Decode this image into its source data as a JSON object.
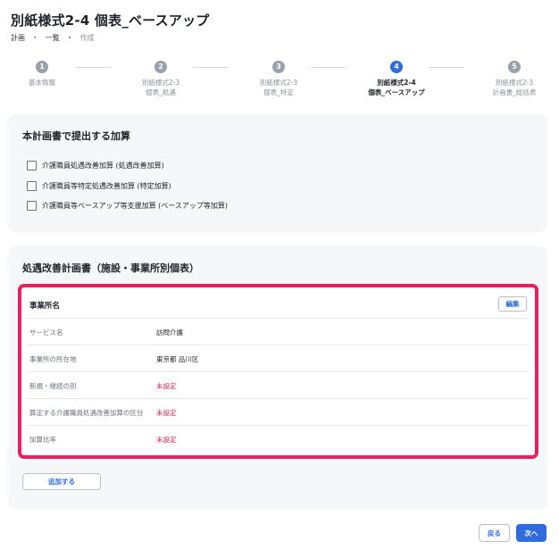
{
  "page": {
    "title": "別紙様式2-4 個表_ベースアップ"
  },
  "breadcrumb": [
    "計画",
    "一覧",
    "作成"
  ],
  "breadcrumb_separator": "•",
  "stepper": {
    "steps": [
      {
        "number": "1",
        "line1": "基本情報",
        "line2": ""
      },
      {
        "number": "2",
        "line1": "別紙様式2-3",
        "line2": "個表_処遇"
      },
      {
        "number": "3",
        "line1": "別紙様式2-3",
        "line2": "個表_特定"
      },
      {
        "number": "4",
        "line1": "別紙様式2-4",
        "line2": "個表_ベースアップ"
      },
      {
        "number": "5",
        "line1": "別紙様式2-3",
        "line2": "計画書_総括表"
      }
    ],
    "active_index": 3
  },
  "additions": {
    "title": "本計画書で提出する加算",
    "options": [
      "介護職員処遇改善加算 (処遇改善加算)",
      "介護職員等特定処遇改善加算 (特定加算)",
      "介護職員等ベースアップ等支援加算 (ベースアップ等加算)"
    ]
  },
  "plan": {
    "title": "処遇改善計画書（施設・事業所別個表）",
    "facility": {
      "header": "事業所名",
      "edit_label": "編集",
      "rows": [
        {
          "label": "サービス名",
          "value": "訪問介護",
          "unset": false
        },
        {
          "label": "事業所の所在地",
          "value": "東京都 品川区",
          "unset": false
        },
        {
          "label": "新規・継続の別",
          "value": "未設定",
          "unset": true
        },
        {
          "label": "算定する介護職員処遇改善加算の区分",
          "value": "未設定",
          "unset": true
        },
        {
          "label": "加算比率",
          "value": "未設定",
          "unset": true
        }
      ]
    },
    "add_label": "追加する"
  },
  "footer": {
    "back_label": "戻る",
    "next_label": "次へ"
  },
  "colors": {
    "accent": "#2f6bdc",
    "highlight": "#ea1f5e",
    "unset_text": "#d0284a"
  }
}
